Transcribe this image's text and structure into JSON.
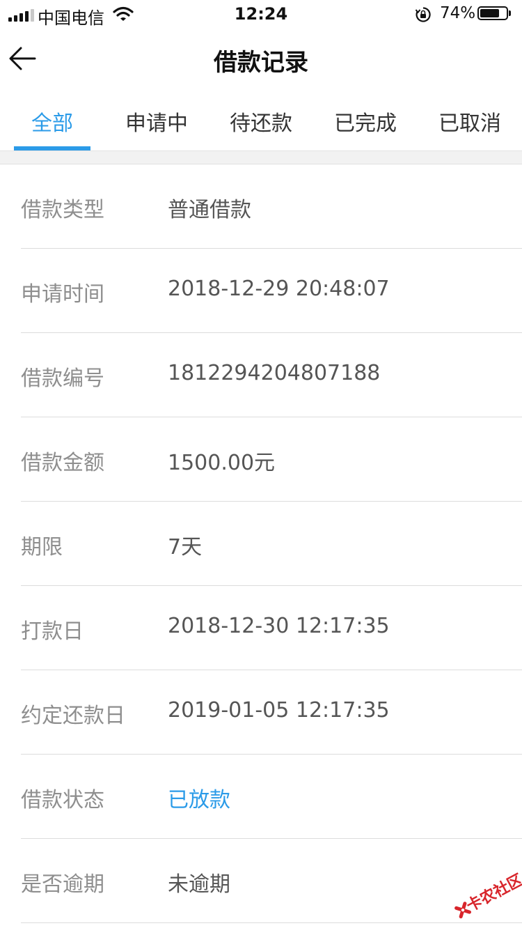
{
  "status_bar": {
    "carrier": "中国电信",
    "time": "12:24",
    "battery_percent": "74%",
    "battery_level": 0.74,
    "signal_bars": 4
  },
  "nav": {
    "title": "借款记录",
    "back_icon": "arrow-left-icon"
  },
  "tabs": [
    {
      "label": "全部",
      "active": true
    },
    {
      "label": "申请中",
      "active": false
    },
    {
      "label": "待还款",
      "active": false
    },
    {
      "label": "已完成",
      "active": false
    },
    {
      "label": "已取消",
      "active": false
    }
  ],
  "details": [
    {
      "label": "借款类型",
      "value": "普通借款"
    },
    {
      "label": "申请时间",
      "value": "2018-12-29 20:48:07"
    },
    {
      "label": "借款编号",
      "value": "1812294204807188"
    },
    {
      "label": "借款金额",
      "value": "1500.00元"
    },
    {
      "label": "期限",
      "value": "7天"
    },
    {
      "label": "打款日",
      "value": "2018-12-30 12:17:35"
    },
    {
      "label": "约定还款日",
      "value": "2019-01-05 12:17:35"
    },
    {
      "label": "借款状态",
      "value": "已放款"
    },
    {
      "label": "是否逾期",
      "value": "未逾期"
    }
  ],
  "watermark": {
    "text": "卡农社区"
  },
  "colors": {
    "accent": "#2b9be8",
    "label_gray": "#8e8e8e",
    "value_gray": "#555555",
    "watermark_red": "#d8252b"
  }
}
